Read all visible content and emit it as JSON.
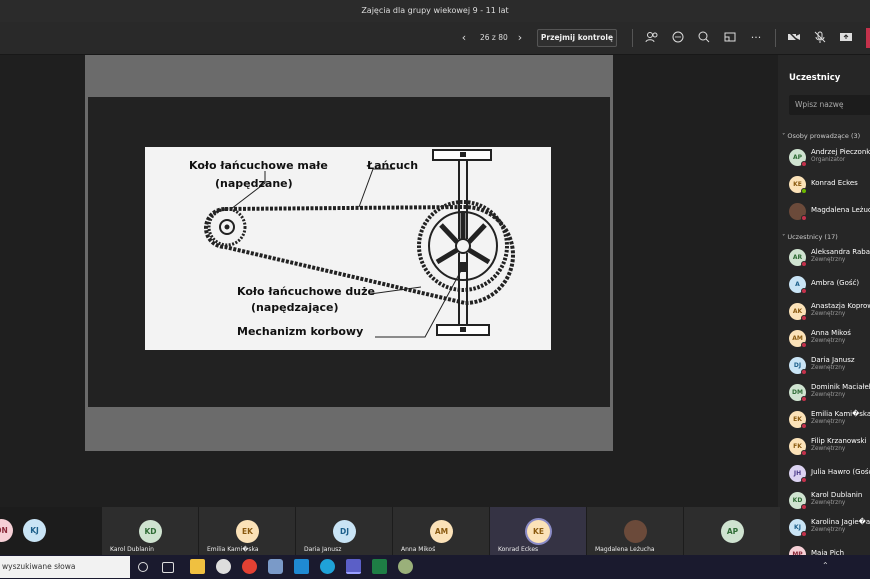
{
  "window": {
    "title": "Zajęcia dla grupy wiekowej 9 - 11 lat"
  },
  "toolbar": {
    "page_counter": "26 z 80",
    "take_control": "Przejmij kontrolę"
  },
  "slide": {
    "labels": {
      "small_sprocket": "Koło łańcuchowe małe",
      "small_sprocket_sub": "(napędzane)",
      "chain": "Łańcuch",
      "big_sprocket": "Koło łańcuchowe duże",
      "big_sprocket_sub": "(napędzające)",
      "crank": "Mechanizm korbowy"
    }
  },
  "panel": {
    "title": "Uczestnicy",
    "search_placeholder": "Wpisz nazwę",
    "presenters_header": "Osoby prowadzące (3)",
    "attendees_header": "Uczestnicy (17)",
    "presenters": [
      {
        "initials": "AP",
        "name": "Andrzej Pieczonka",
        "sub": "Organizator",
        "bg": "#cfe3d0",
        "fg": "#2e6b34",
        "status": "#c4314b"
      },
      {
        "initials": "KE",
        "name": "Konrad Eckes",
        "sub": "",
        "bg": "#fbe2b8",
        "fg": "#8a5a10",
        "status": "#6bb700"
      },
      {
        "initials": "",
        "name": "Magdalena Leżuch",
        "sub": "",
        "bg": "#6b4a3a",
        "fg": "#fff",
        "status": "#c4314b"
      }
    ],
    "attendees": [
      {
        "initials": "AR",
        "name": "Aleksandra Raba",
        "sub": "Zewnętrzny",
        "bg": "#cfe3d0",
        "fg": "#2e6b34",
        "status": "#c4314b"
      },
      {
        "initials": "A",
        "name": "Ambra (Gość)",
        "sub": "",
        "bg": "#c9e4f5",
        "fg": "#1b5e8a",
        "status": "#c4314b"
      },
      {
        "initials": "AK",
        "name": "Anastazja Koprow",
        "sub": "Zewnętrzny",
        "bg": "#fbe2b8",
        "fg": "#8a5a10",
        "status": "#c4314b"
      },
      {
        "initials": "AM",
        "name": "Anna Mikoś",
        "sub": "Zewnętrzny",
        "bg": "#fbe2b8",
        "fg": "#8a5a10",
        "status": "#c4314b"
      },
      {
        "initials": "DJ",
        "name": "Daria Janusz",
        "sub": "Zewnętrzny",
        "bg": "#c9e4f5",
        "fg": "#1b5e8a",
        "status": "#c4314b"
      },
      {
        "initials": "DM",
        "name": "Dominik Maciałek",
        "sub": "Zewnętrzny",
        "bg": "#cfe3d0",
        "fg": "#2e6b34",
        "status": "#c4314b"
      },
      {
        "initials": "EK",
        "name": "Emilia Kami�ska",
        "sub": "Zewnętrzny",
        "bg": "#fbe2b8",
        "fg": "#8a5a10",
        "status": "#c4314b"
      },
      {
        "initials": "FK",
        "name": "Filip Krzanowski",
        "sub": "Zewnętrzny",
        "bg": "#fbe2b8",
        "fg": "#8a5a10",
        "status": "#c4314b"
      },
      {
        "initials": "JH",
        "name": "Julia Hawro (Gość)",
        "sub": "",
        "bg": "#dcd3f2",
        "fg": "#4b3a8a",
        "status": "#c4314b"
      },
      {
        "initials": "KD",
        "name": "Karol Dublanin",
        "sub": "Zewnętrzny",
        "bg": "#cfe3d0",
        "fg": "#2e6b34",
        "status": "#c4314b"
      },
      {
        "initials": "KJ",
        "name": "Karolina Jagie�a",
        "sub": "Zewnętrzny",
        "bg": "#c9e4f5",
        "fg": "#1b5e8a",
        "status": "#c4314b"
      },
      {
        "initials": "MP",
        "name": "Maja Pich",
        "sub": "",
        "bg": "#f6d0d6",
        "fg": "#8a2a3a",
        "status": "#c4314b"
      }
    ]
  },
  "strip": {
    "circles": [
      {
        "initials": "ON",
        "bg": "#f6d0d6",
        "fg": "#8a2a3a"
      },
      {
        "initials": "KJ",
        "bg": "#c9e4f5",
        "fg": "#1b5e8a"
      }
    ],
    "tiles": [
      {
        "initials": "KD",
        "name": "Karol Dublanin",
        "bg": "#cfe3d0",
        "fg": "#2e6b34"
      },
      {
        "initials": "EK",
        "name": "Emilia Kami�ska",
        "bg": "#fbe2b8",
        "fg": "#8a5a10"
      },
      {
        "initials": "DJ",
        "name": "Daria Janusz",
        "bg": "#c9e4f5",
        "fg": "#1b5e8a"
      },
      {
        "initials": "AM",
        "name": "Anna Mikoś",
        "bg": "#fbe2b8",
        "fg": "#8a5a10"
      },
      {
        "initials": "KE",
        "name": "Konrad Eckes",
        "bg": "#fbe2b8",
        "fg": "#8a5a10"
      },
      {
        "initials": "",
        "name": "Magdalena Leżucha",
        "bg": "#6b4a3a",
        "fg": "#fff"
      },
      {
        "initials": "AP",
        "name": "",
        "bg": "#cfe3d0",
        "fg": "#2e6b34"
      }
    ]
  },
  "taskbar": {
    "search_text": "wyszukiwane słowa"
  }
}
